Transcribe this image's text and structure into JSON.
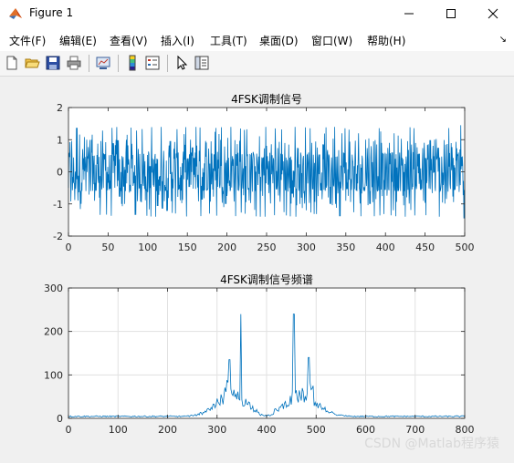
{
  "window": {
    "title": "Figure 1"
  },
  "menu": {
    "items": [
      "文件(F)",
      "编辑(E)",
      "查看(V)",
      "插入(I)",
      "工具(T)",
      "桌面(D)",
      "窗口(W)",
      "帮助(H)"
    ],
    "overflow_icon": "dock-arrow-icon"
  },
  "toolbar": {
    "icons": [
      "new-figure-icon",
      "open-file-icon",
      "save-icon",
      "print-icon",
      "link-plot-icon",
      "insert-colorbar-icon",
      "insert-legend-icon",
      "edit-plot-icon",
      "property-inspector-icon"
    ]
  },
  "chart_data": [
    {
      "type": "line",
      "title": "4FSK调制信号",
      "xlim": [
        0,
        500
      ],
      "ylim": [
        -2,
        2
      ],
      "xticks": [
        0,
        50,
        100,
        150,
        200,
        250,
        300,
        350,
        400,
        450,
        500
      ],
      "yticks": [
        -2,
        -1,
        0,
        1,
        2
      ],
      "grid": false,
      "color": "#0072BD",
      "signal": "4FSK modulated waveform, amplitude between -1.4 and 1.4, dense oscillation across 0–500"
    },
    {
      "type": "line",
      "title": "4FSK调制信号频谱",
      "xlim": [
        0,
        800
      ],
      "ylim": [
        0,
        300
      ],
      "xticks": [
        0,
        100,
        200,
        300,
        400,
        500,
        600,
        700,
        800
      ],
      "yticks": [
        0,
        100,
        200,
        300
      ],
      "grid": true,
      "color": "#0072BD",
      "peaks": [
        {
          "x": 348,
          "y": 240
        },
        {
          "x": 455,
          "y": 240
        },
        {
          "x": 325,
          "y": 135
        },
        {
          "x": 485,
          "y": 140
        }
      ],
      "spectrum_band": [
        240,
        580
      ]
    }
  ],
  "watermark": "CSDN @Matlab程序猿"
}
